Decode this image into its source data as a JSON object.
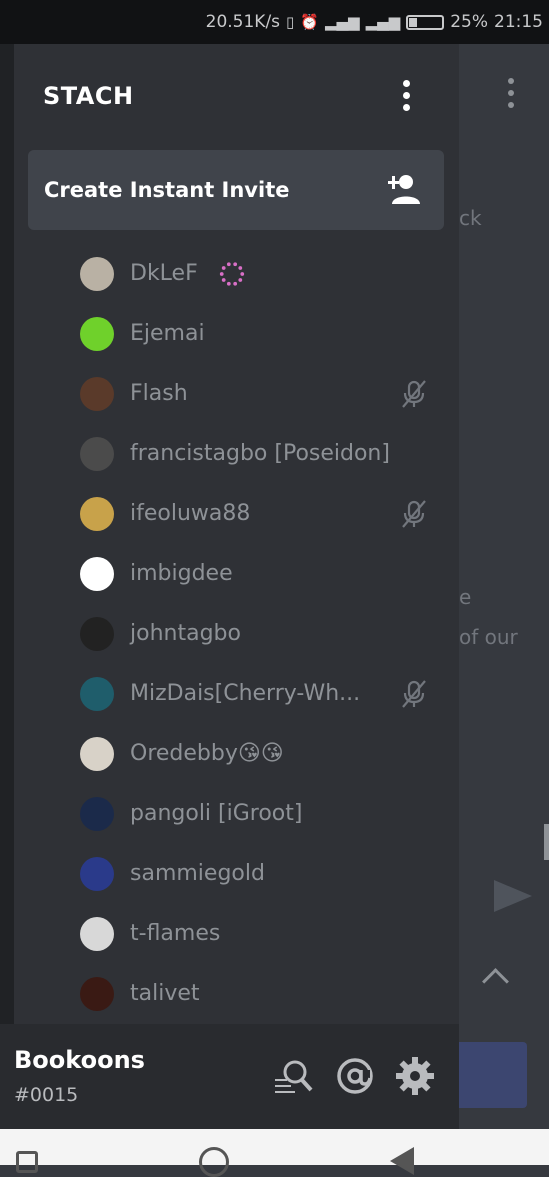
{
  "status_bar": {
    "speed": "20.51K/s",
    "battery": "25%",
    "time": "21:15"
  },
  "background": {
    "frag1": "ck",
    "frag2": "e",
    "frag3": "of our"
  },
  "drawer": {
    "server_name": "STACH",
    "invite_label": "Create Instant Invite",
    "members": [
      {
        "name": "DkLeF",
        "avatar_color": "#b9b1a4",
        "muted": false,
        "extra": "loading"
      },
      {
        "name": "Ejemai",
        "avatar_color": "#6fd12b",
        "muted": false
      },
      {
        "name": "Flash",
        "avatar_color": "#5a3a2a",
        "muted": true
      },
      {
        "name": "francistagbo [Poseidon]",
        "avatar_color": "#4b4b4b",
        "muted": false
      },
      {
        "name": "ifeoluwa88",
        "avatar_color": "#c8a24a",
        "muted": true
      },
      {
        "name": "imbigdee",
        "avatar_color": "#ffffff",
        "muted": false
      },
      {
        "name": "johntagbo",
        "avatar_color": "#222222",
        "muted": false
      },
      {
        "name": "MizDais[Cherry-Wh...",
        "avatar_color": "#1f5d6b",
        "muted": true
      },
      {
        "name": "Oredebby😘😘",
        "avatar_color": "#d8d2c8",
        "muted": false
      },
      {
        "name": "pangoli [iGroot]",
        "avatar_color": "#1b2a4a",
        "muted": false
      },
      {
        "name": "sammiegold",
        "avatar_color": "#2a3a8a",
        "muted": false
      },
      {
        "name": "t-flames",
        "avatar_color": "#d8d8d8",
        "muted": false
      },
      {
        "name": "talivet",
        "avatar_color": "#3a1a14",
        "muted": false
      }
    ]
  },
  "footer": {
    "username": "Bookoons",
    "discriminator": "#0015"
  }
}
